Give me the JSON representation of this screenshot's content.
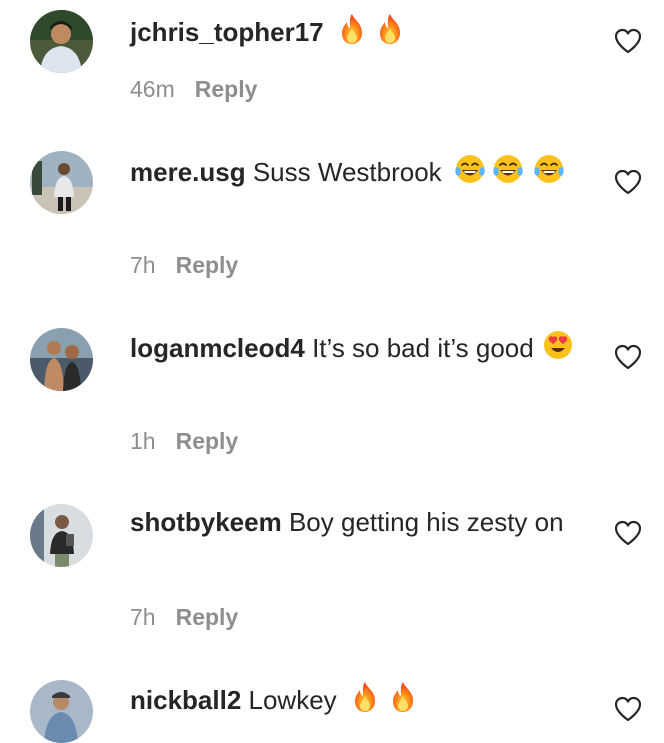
{
  "comments": [
    {
      "username": "jchris_topher17",
      "text": "",
      "emojis": [
        "fire",
        "fire"
      ],
      "time": "46m",
      "reply_label": "Reply"
    },
    {
      "username": "mere.usg",
      "text": "Suss Westbrook",
      "emojis": [
        "tears-of-joy",
        "tears-of-joy",
        "tears-of-joy"
      ],
      "time": "7h",
      "reply_label": "Reply"
    },
    {
      "username": "loganmcleod4",
      "text": "It’s so bad it’s good",
      "emojis": [
        "heart-eyes"
      ],
      "time": "1h",
      "reply_label": "Reply"
    },
    {
      "username": "shotbykeem",
      "text": "Boy getting his zesty on",
      "emojis": [],
      "time": "7h",
      "reply_label": "Reply"
    },
    {
      "username": "nickball2",
      "text": "Lowkey",
      "emojis": [
        "fire",
        "fire"
      ],
      "time": "",
      "reply_label": ""
    }
  ],
  "icons": {
    "like": "heart-outline-icon",
    "avatar": "user-avatar"
  },
  "colors": {
    "text": "#262626",
    "secondary": "#8e8e8e",
    "background": "#ffffff"
  }
}
